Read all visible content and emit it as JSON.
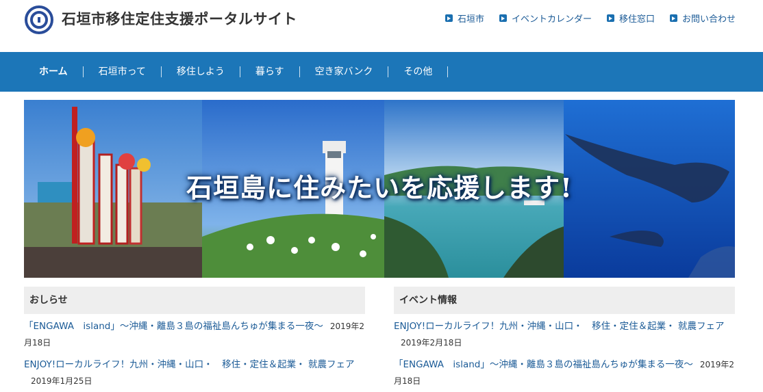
{
  "site": {
    "title": "石垣市移住定住支援ポータルサイト",
    "logo_icon": "city-emblem-icon"
  },
  "toplinks": [
    {
      "label": "石垣市"
    },
    {
      "label": "イベントカレンダー"
    },
    {
      "label": "移住窓口"
    },
    {
      "label": "お問い合わせ"
    }
  ],
  "nav": [
    {
      "label": "ホーム"
    },
    {
      "label": "石垣市って"
    },
    {
      "label": "移住しよう"
    },
    {
      "label": "暮らす"
    },
    {
      "label": "空き家バンク"
    },
    {
      "label": "その他"
    }
  ],
  "hero": {
    "caption": "石垣島に住みたいを応援します!"
  },
  "news": {
    "heading": "おしらせ",
    "items": [
      {
        "title": "「ENGAWA　island」～沖縄・離島３島の福祉島んちゅが集まる一夜～",
        "date": "2019年2月18日"
      },
      {
        "title": "ENJOY!ローカルライフ！九州・沖縄・山口・　移住・定住＆起業・ 就農フェア",
        "date": "2019年1月25日"
      }
    ]
  },
  "events": {
    "heading": "イベント情報",
    "items": [
      {
        "title": "ENJOY!ローカルライフ！九州・沖縄・山口・　移住・定住＆起業・ 就農フェア",
        "date": "2019年2月18日"
      },
      {
        "title": "「ENGAWA　island」～沖縄・離島３島の福祉島んちゅが集まる一夜～",
        "date": "2019年2月18日"
      }
    ]
  },
  "colors": {
    "nav_bg": "#1c76b8",
    "link": "#1a5a96",
    "heading_bg": "#eeeeee"
  }
}
